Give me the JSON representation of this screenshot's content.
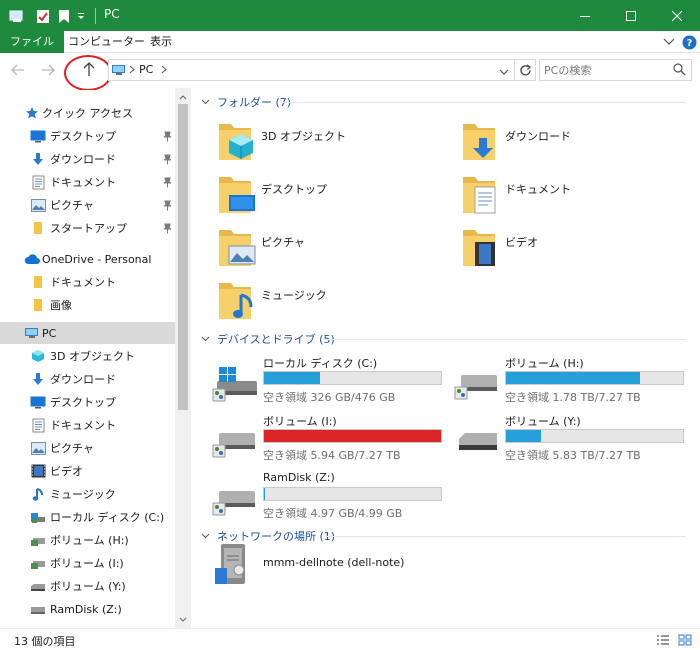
{
  "window": {
    "title": "PC",
    "title_bar_color": "#1e8a3e"
  },
  "ribbon": {
    "tabs": [
      {
        "label": "ファイル",
        "active": true
      },
      {
        "label": "コンピューター"
      },
      {
        "label": "表示"
      }
    ]
  },
  "address": {
    "path_segments": [
      "PC"
    ],
    "search_placeholder": "PCの検索"
  },
  "sidebar": {
    "quick_access": {
      "label": "クイック アクセス",
      "items": [
        {
          "label": "デスクトップ",
          "icon": "desktop-icon",
          "pinned": true
        },
        {
          "label": "ダウンロード",
          "icon": "download-icon",
          "pinned": true
        },
        {
          "label": "ドキュメント",
          "icon": "documents-icon",
          "pinned": true
        },
        {
          "label": "ピクチャ",
          "icon": "pictures-icon",
          "pinned": true
        },
        {
          "label": "スタートアップ",
          "icon": "folder-icon",
          "pinned": true
        }
      ]
    },
    "onedrive": {
      "label": "OneDrive - Personal",
      "items": [
        {
          "label": "ドキュメント",
          "icon": "folder-icon"
        },
        {
          "label": "画像",
          "icon": "folder-icon"
        }
      ]
    },
    "pc": {
      "label": "PC",
      "items": [
        {
          "label": "3D オブジェクト",
          "icon": "3d-objects-icon"
        },
        {
          "label": "ダウンロード",
          "icon": "download-icon"
        },
        {
          "label": "デスクトップ",
          "icon": "desktop-icon"
        },
        {
          "label": "ドキュメント",
          "icon": "documents-icon"
        },
        {
          "label": "ピクチャ",
          "icon": "pictures-icon"
        },
        {
          "label": "ビデオ",
          "icon": "videos-icon"
        },
        {
          "label": "ミュージック",
          "icon": "music-icon"
        },
        {
          "label": "ローカル ディスク (C:)",
          "icon": "drive-icon"
        },
        {
          "label": "ボリューム (H:)",
          "icon": "drive-icon"
        },
        {
          "label": "ボリューム (I:)",
          "icon": "drive-icon"
        },
        {
          "label": "ボリューム (Y:)",
          "icon": "drive-icon"
        },
        {
          "label": "RamDisk (Z:)",
          "icon": "drive-icon"
        }
      ]
    }
  },
  "main": {
    "folders_section": {
      "label": "フォルダー (7)"
    },
    "folders": [
      {
        "label": "3D オブジェクト",
        "icon": "3d-objects-folder-icon"
      },
      {
        "label": "ダウンロード",
        "icon": "download-folder-icon"
      },
      {
        "label": "デスクトップ",
        "icon": "desktop-folder-icon"
      },
      {
        "label": "ドキュメント",
        "icon": "documents-folder-icon"
      },
      {
        "label": "ピクチャ",
        "icon": "pictures-folder-icon"
      },
      {
        "label": "ビデオ",
        "icon": "videos-folder-icon"
      },
      {
        "label": "ミュージック",
        "icon": "music-folder-icon"
      }
    ],
    "drives_section": {
      "label": "デバイスとドライブ (5)"
    },
    "drives": [
      {
        "label": "ローカル ディスク (C:)",
        "info": "空き領域 326 GB/476 GB",
        "used_fraction": 0.315,
        "bar_color": "#26a0da"
      },
      {
        "label": "ボリューム (H:)",
        "info": "空き領域 1.78 TB/7.27 TB",
        "used_fraction": 0.755,
        "bar_color": "#26a0da"
      },
      {
        "label": "ボリューム (I:)",
        "info": "空き領域 5.94 GB/7.27 TB",
        "used_fraction": 0.999,
        "bar_color": "#da2626"
      },
      {
        "label": "ボリューム (Y:)",
        "info": "空き領域 5.83 TB/7.27 TB",
        "used_fraction": 0.198,
        "bar_color": "#26a0da"
      },
      {
        "label": "RamDisk (Z:)",
        "info": "空き領域 4.97 GB/4.99 GB",
        "used_fraction": 0.004,
        "bar_color": "#26a0da"
      }
    ],
    "network_section": {
      "label": "ネットワークの場所 (1)"
    },
    "network": [
      {
        "label": "mmm-dellnote (dell-note)"
      }
    ]
  },
  "status": {
    "item_count": "13 個の項目"
  }
}
